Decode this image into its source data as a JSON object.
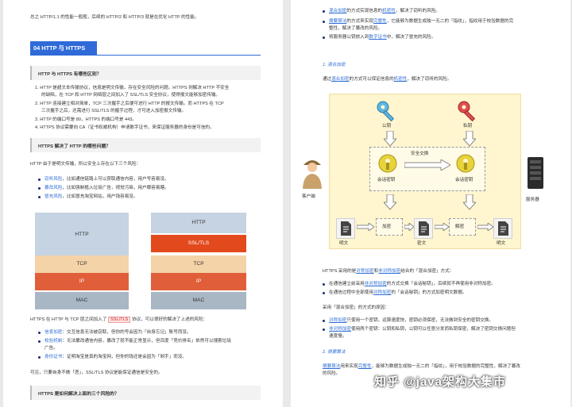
{
  "left": {
    "intro": "总之 HTTP/1.1 的性能一般般，后续的 HTTP/2 和 HTTP/3 就是在优化 HTTP 的性能。",
    "section_title": "04 HTTP 与 HTTPS",
    "q1": "HTTP 与 HTTPS 有哪些区别？",
    "q1_items": [
      [
        "1. HTTP 是超文本传输协议，信息是明文传输，存在安全风险的问题。HTTPS 则解决 HTTP 不安全",
        "的缺陷，在 TCP 和 HTTP 网络层之间加入了 SSL/TLS 安全协议，使得报文能够加密传输。"
      ],
      [
        "2. HTTP 连接建立相对简单，TCP 三次握手之后便可进行 HTTP 的报文传输。而 HTTPS 在 TCP",
        "三次握手之后，还需进行 SSL/TLS 的握手过程，才可进入加密报文传输。"
      ],
      [
        "3. HTTP 的端口号是 80，HTTPS 的端口号是 443。"
      ],
      [
        "4. HTTPS 协议需要向 CA（证书权威机构）申请数字证书，来保证服务器的身份是可信的。"
      ]
    ],
    "q2": "HTTPS 解决了 HTTP 的哪些问题？",
    "q2_intro": "HTTP 由于是明文传输，所以安全上存在以下三个风险：",
    "risks": [
      {
        "k": "窃听风险",
        "v": "，比如通信链路上可以获取通信内容，用户号容易没。"
      },
      {
        "k": "篡改风险",
        "v": "，比如强制植入垃圾广告，视觉污染，用户眼容易瞎。"
      },
      {
        "k": "冒充风险",
        "v": "，比如冒充淘宝网站，用户钱容易没。"
      }
    ],
    "stack_left": [
      "HTTP",
      "TCP",
      "IP",
      "MAC"
    ],
    "stack_right": [
      "HTTP",
      "SSL/TLS",
      "TCP",
      "IP",
      "MAC"
    ],
    "https_sentence_a": "HTTPS 在 HTTP 与 TCP 层之间加入了",
    "https_sentence_hl": "SSL/TLS",
    "https_sentence_b": "协议，可以很好的解决了上述的风险：",
    "fixes": [
      {
        "k": "信息加密",
        "v": "：交互信息无法被窃取，但你的号会因为「自身忘记」账号而没。"
      },
      {
        "k": "校验机制",
        "v": "：无法篡改通信内容，篡改了就不能正常显示，但百度「竞价排名」依然可以搜索垃圾",
        "v2": "广告。"
      },
      {
        "k": "身份证书",
        "v": "：证明淘宝是真的淘宝网，但你的钱还是会因为「剁手」而没。"
      }
    ],
    "conclusion": "可见，只要自身不做「恶」，SSL/TLS 协议是能保证通信是安全的。",
    "q3": "HTTPS 是如何解决上面的三个风险的？"
  },
  "right": {
    "bullets": [
      {
        "k": "混合加密",
        "v": "的方式实现信息的",
        "k2": "机密性",
        "v2": "，解决了窃听的风险。"
      },
      {
        "k": "摘要算法",
        "v": "的方式来实现",
        "k2": "完整性",
        "v2": "，它能够为数据生成独一无二的「指纹」，指纹用于校验数据的完",
        "v3": "整性，解决了篡改的风险。"
      },
      {
        "k": "",
        "v": "将服务器公钥放入到",
        "k2": "数字证书",
        "v2": "中，解决了冒充的风险。"
      }
    ],
    "h1": "1. 混合加密",
    "h1_desc_a": "通过",
    "h1_desc_k": "混合加密",
    "h1_desc_b": "的方式可以保证信息的",
    "h1_desc_k2": "机密性",
    "h1_desc_c": "，解决了窃听的风险。",
    "diagram": {
      "public_key": "公钥",
      "private_key": "私钥",
      "secure_exchange": "安全交换",
      "session_key_a": "会话密钥",
      "session_key_b": "会话密钥",
      "client": "客户端",
      "server": "服务器",
      "encrypt": "加密",
      "decrypt": "解密",
      "plaintext_a": "明文",
      "ciphertext": "密文",
      "plaintext_b": "明文"
    },
    "mix_desc_a": "HTTPS 采用的是",
    "mix_desc_k": "对称加密",
    "mix_desc_b": "和",
    "mix_desc_k2": "非对称加密",
    "mix_desc_c": "结合的「混合加密」方式：",
    "mix_items": [
      [
        "在通信建立前采用",
        "非对称加密",
        "的方式交换「会话秘钥」，后续就不再使用非对称加密。"
      ],
      [
        "在通信过程中全部使用",
        "对称加密",
        "的「会话秘钥」的方式加密明文数据。"
      ]
    ],
    "why": "采用「混合加密」的方式的原因：",
    "why_items": [
      [
        "对称加密",
        "只使用一个密钥，运算速度快，密钥必须保密，无法做到安全的密钥交换。"
      ],
      [
        "非对称加密",
        "使用两个密钥：公钥和私钥，公钥可以任意分发而私钥保密，解决了密钥交换问题但",
        "速度慢。"
      ]
    ],
    "h2": "2. 摘要算法",
    "digest_k": "摘要算法",
    "digest_a": "用来实现",
    "digest_k2": "完整性",
    "digest_b": "，能够为数据生成独一无二的「指纹」，用于校验数据的完整性，解决了篡改",
    "digest_c": "的风险。"
  },
  "watermark": "知乎 @java架构大集市",
  "colors": {
    "accent": "#2f6ad8",
    "ssl": "#e24a1e",
    "diagram_bg": "#fff5cf"
  }
}
